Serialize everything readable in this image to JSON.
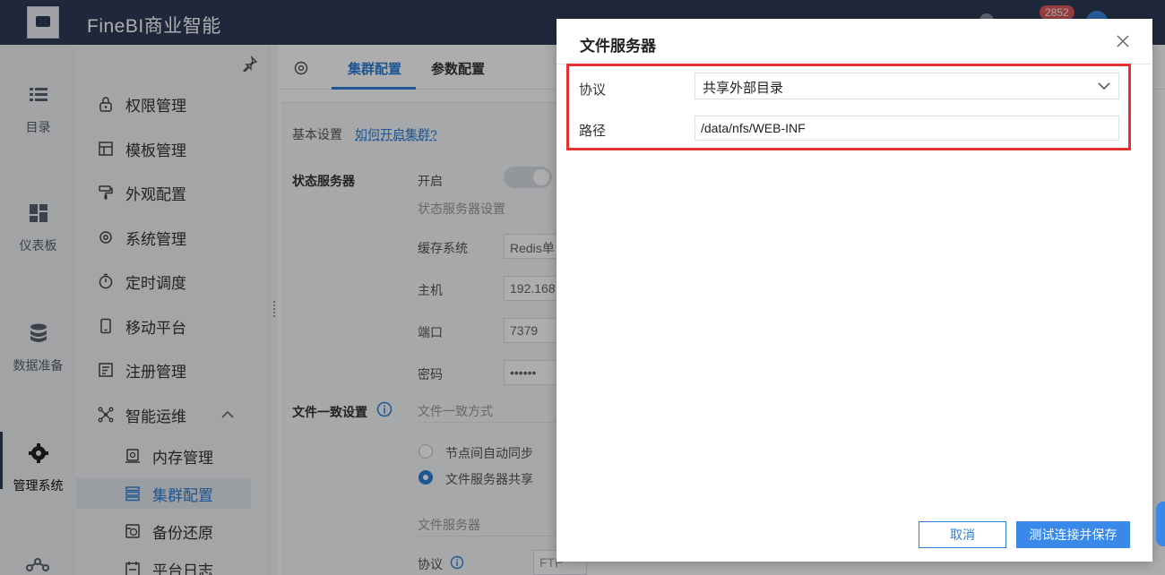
{
  "app": {
    "title": "FineBI商业智能",
    "notification_count": "2852"
  },
  "rail": {
    "items": [
      {
        "label": "目录",
        "icon": "list-icon"
      },
      {
        "label": "仪表板",
        "icon": "dashboard-icon"
      },
      {
        "label": "数据准备",
        "icon": "database-icon"
      },
      {
        "label": "管理系统",
        "icon": "gear-icon",
        "active": true
      }
    ]
  },
  "subnav": {
    "items": [
      {
        "label": "权限管理",
        "icon": "lock-icon"
      },
      {
        "label": "模板管理",
        "icon": "template-icon"
      },
      {
        "label": "外观配置",
        "icon": "paint-roller-icon"
      },
      {
        "label": "系统管理",
        "icon": "gear-icon"
      },
      {
        "label": "定时调度",
        "icon": "timer-icon"
      },
      {
        "label": "移动平台",
        "icon": "mobile-icon"
      },
      {
        "label": "注册管理",
        "icon": "register-icon"
      },
      {
        "label": "智能运维",
        "icon": "network-icon",
        "expanded": true
      },
      {
        "label": "内存管理",
        "icon": "memory-icon",
        "sub": true
      },
      {
        "label": "集群配置",
        "icon": "cluster-icon",
        "sub": true,
        "active": true
      },
      {
        "label": "备份还原",
        "icon": "backup-icon",
        "sub": true
      },
      {
        "label": "平台日志",
        "icon": "log-icon",
        "sub": true
      }
    ]
  },
  "tabs": [
    {
      "label": "集群配置",
      "active": true
    },
    {
      "label": "参数配置"
    }
  ],
  "content": {
    "basic_label": "基本设置",
    "basic_link": "如何开启集群?",
    "state_server_label": "状态服务器",
    "enable_label": "开启",
    "state_server_settings": "状态服务器设置",
    "cache_system_label": "缓存系统",
    "cache_system_value": "Redis单",
    "host_label": "主机",
    "host_value": "192.168",
    "port_label": "端口",
    "port_value": "7379",
    "password_label": "密码",
    "password_value": "••••••",
    "file_consistency_label": "文件一致设置",
    "file_consistency_mode": "文件一致方式",
    "option_auto_sync": "节点间自动同步",
    "option_file_server": "文件服务器共享",
    "file_server_label": "文件服务器",
    "protocol_label": "协议",
    "protocol_value": "FTP"
  },
  "dialog": {
    "title": "文件服务器",
    "protocol_label": "协议",
    "protocol_value": "共享外部目录",
    "path_label": "路径",
    "path_value": "/data/nfs/WEB-INF",
    "cancel_label": "取消",
    "save_label": "测试连接并保存"
  },
  "colors": {
    "topbar": "#2e3b57",
    "accent": "#2b7fd9",
    "highlight": "#e23232"
  }
}
